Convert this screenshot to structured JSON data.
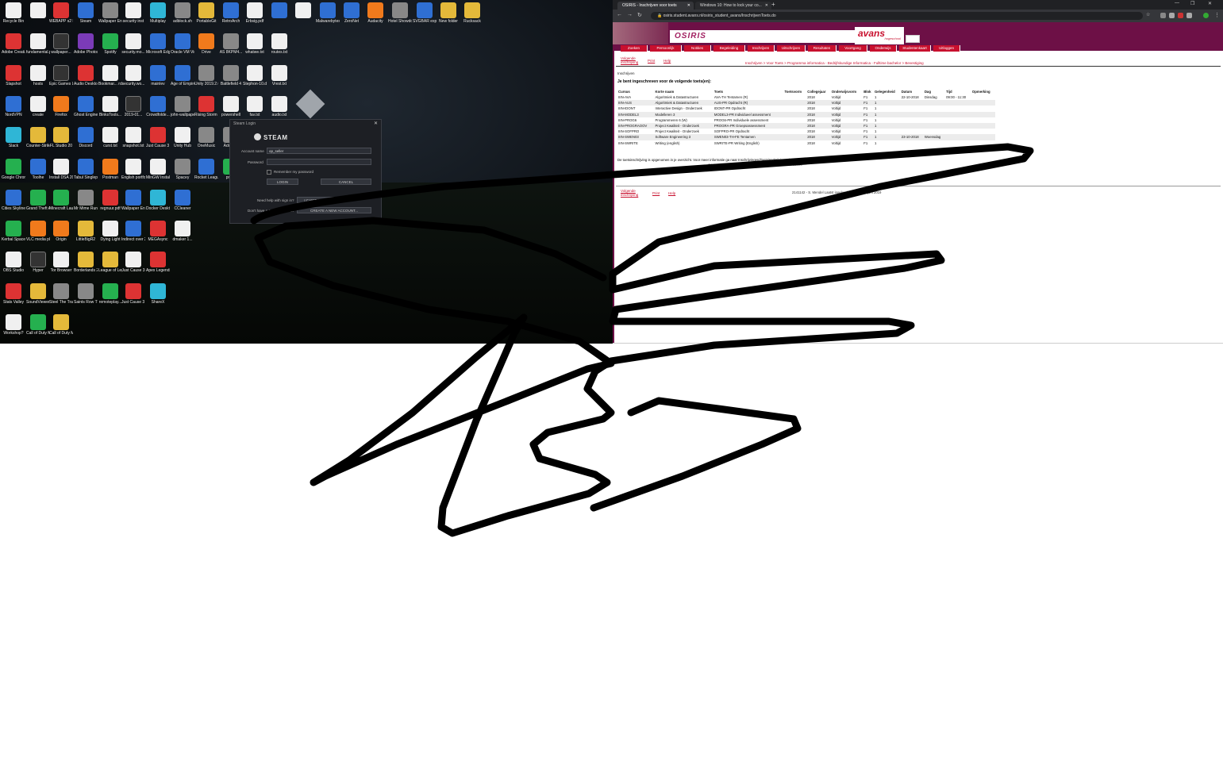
{
  "desktop": {
    "icons": [
      {
        "label": "Recycle Bin",
        "color": "g-white",
        "col": 0,
        "row": 0
      },
      {
        "label": "",
        "color": "g-white",
        "col": 1,
        "row": 0
      },
      {
        "label": "WEBAPP s2 Installation...",
        "color": "g-red",
        "col": 2,
        "row": 0
      },
      {
        "label": "Steam",
        "color": "g-blue",
        "col": 3,
        "row": 0
      },
      {
        "label": "Wallpaper Engine",
        "color": "g-gray",
        "col": 4,
        "row": 0
      },
      {
        "label": "security inst",
        "color": "g-white",
        "col": 5,
        "row": 0
      },
      {
        "label": "Multiplay",
        "color": "g-cyan",
        "col": 6,
        "row": 0
      },
      {
        "label": "adblock.sh",
        "color": "g-gray",
        "col": 7,
        "row": 0
      },
      {
        "label": "PortableGit",
        "color": "g-yellow",
        "col": 8,
        "row": 0
      },
      {
        "label": "RetroArch",
        "color": "g-blue",
        "col": 9,
        "row": 0
      },
      {
        "label": "Erbsig.pdf",
        "color": "g-white",
        "col": 10,
        "row": 0
      },
      {
        "label": "",
        "color": "g-blue",
        "col": 11,
        "row": 0
      },
      {
        "label": "",
        "color": "g-white",
        "col": 12,
        "row": 0
      },
      {
        "label": "Malwarebytes",
        "color": "g-blue",
        "col": 13,
        "row": 0
      },
      {
        "label": "ZeroNet",
        "color": "g-blue",
        "col": 14,
        "row": 0
      },
      {
        "label": "Audacity",
        "color": "g-orange",
        "col": 15,
        "row": 0
      },
      {
        "label": "Hotel Showdown",
        "color": "g-gray",
        "col": 16,
        "row": 0
      },
      {
        "label": "SVGBAR explorer",
        "color": "g-blue",
        "col": 17,
        "row": 0
      },
      {
        "label": "New folder",
        "color": "g-yellow",
        "col": 18,
        "row": 0
      },
      {
        "label": "Rucksack",
        "color": "g-yellow",
        "col": 19,
        "row": 0
      },
      {
        "label": "Adobe Creati...",
        "color": "g-red",
        "col": 0,
        "row": 1
      },
      {
        "label": "fundamental.p...",
        "color": "g-white",
        "col": 1,
        "row": 1
      },
      {
        "label": "wallpaper...",
        "color": "g-dark",
        "col": 2,
        "row": 1
      },
      {
        "label": "Adobe Photoshop",
        "color": "g-purple",
        "col": 3,
        "row": 1
      },
      {
        "label": "Spotify",
        "color": "g-green",
        "col": 4,
        "row": 1
      },
      {
        "label": "security.mo...",
        "color": "g-white",
        "col": 5,
        "row": 1
      },
      {
        "label": "Microsoft Edge",
        "color": "g-blue",
        "col": 6,
        "row": 1
      },
      {
        "label": "Oracle VM VirtualBox",
        "color": "g-blue",
        "col": 7,
        "row": 1
      },
      {
        "label": "Drive",
        "color": "g-orange",
        "col": 8,
        "row": 1
      },
      {
        "label": "AS 8KPM4...",
        "color": "g-gray",
        "col": 9,
        "row": 1
      },
      {
        "label": "whatwe.txt",
        "color": "g-white",
        "col": 10,
        "row": 1
      },
      {
        "label": "routes.txt",
        "color": "g-white",
        "col": 11,
        "row": 1
      },
      {
        "label": "Slapshot",
        "color": "g-red",
        "col": 0,
        "row": 2
      },
      {
        "label": "hosts",
        "color": "g-white",
        "col": 1,
        "row": 2
      },
      {
        "label": "Epic Games Launcher",
        "color": "g-dark",
        "col": 2,
        "row": 2
      },
      {
        "label": "Audio Desktop",
        "color": "g-red",
        "col": 3,
        "row": 2
      },
      {
        "label": "Bookmar... rdd.txt",
        "color": "g-white",
        "col": 4,
        "row": 2
      },
      {
        "label": "security.wo...",
        "color": "g-white",
        "col": 5,
        "row": 2
      },
      {
        "label": "mainlev",
        "color": "g-blue",
        "col": 6,
        "row": 2
      },
      {
        "label": "Age of Empires II",
        "color": "g-blue",
        "col": 7,
        "row": 2
      },
      {
        "label": "Unity 2019.2.0...",
        "color": "g-gray",
        "col": 8,
        "row": 2
      },
      {
        "label": "Battlefield 4",
        "color": "g-gray",
        "col": 9,
        "row": 2
      },
      {
        "label": "Stephon-10.dll",
        "color": "g-white",
        "col": 10,
        "row": 2
      },
      {
        "label": "Vrest.txt",
        "color": "g-white",
        "col": 11,
        "row": 2
      },
      {
        "label": "NordVPN",
        "color": "g-blue",
        "col": 0,
        "row": 3
      },
      {
        "label": "create",
        "color": "g-white",
        "col": 1,
        "row": 3
      },
      {
        "label": "Firefox",
        "color": "g-orange",
        "col": 2,
        "row": 3
      },
      {
        "label": "Ghost Engine",
        "color": "g-blue",
        "col": 3,
        "row": 3
      },
      {
        "label": "BinksTools...",
        "color": "g-white",
        "col": 4,
        "row": 3
      },
      {
        "label": "2019-01...",
        "color": "g-dark",
        "col": 5,
        "row": 3
      },
      {
        "label": "Crowdfolde...",
        "color": "g-blue",
        "col": 6,
        "row": 3
      },
      {
        "label": "john-wallpaper",
        "color": "g-gray",
        "col": 7,
        "row": 3
      },
      {
        "label": "Rising Storm 2 Vietnam",
        "color": "g-red",
        "col": 8,
        "row": 3
      },
      {
        "label": "powershell",
        "color": "g-white",
        "col": 9,
        "row": 3
      },
      {
        "label": "fav.txt",
        "color": "g-white",
        "col": 10,
        "row": 3
      },
      {
        "label": "audio.txt",
        "color": "g-white",
        "col": 11,
        "row": 3
      },
      {
        "label": "Slack",
        "color": "g-cyan",
        "col": 0,
        "row": 4
      },
      {
        "label": "Counter-Strike Global Off...",
        "color": "g-yellow",
        "col": 1,
        "row": 4
      },
      {
        "label": "FL Studio 20",
        "color": "g-yellow",
        "col": 2,
        "row": 4
      },
      {
        "label": "Discord",
        "color": "g-blue",
        "col": 3,
        "row": 4
      },
      {
        "label": "curst.txt",
        "color": "g-white",
        "col": 4,
        "row": 4
      },
      {
        "label": "snapshot.txt",
        "color": "g-white",
        "col": 5,
        "row": 4
      },
      {
        "label": "Just Cause 3 Multiplayer",
        "color": "g-red",
        "col": 6,
        "row": 4
      },
      {
        "label": "Unity Hub",
        "color": "g-white",
        "col": 7,
        "row": 4
      },
      {
        "label": "OneMusic",
        "color": "g-gray",
        "col": 8,
        "row": 4
      },
      {
        "label": "Adobe...",
        "color": "g-gray",
        "col": 9,
        "row": 4
      },
      {
        "label": "Google Chrome",
        "color": "g-green",
        "col": 0,
        "row": 5
      },
      {
        "label": "Toolhe",
        "color": "g-blue",
        "col": 1,
        "row": 5
      },
      {
        "label": "Install DSA 2019...",
        "color": "g-white",
        "col": 2,
        "row": 5
      },
      {
        "label": "Tabul Singleplayer",
        "color": "g-blue",
        "col": 3,
        "row": 5
      },
      {
        "label": "Postman",
        "color": "g-orange",
        "col": 4,
        "row": 5
      },
      {
        "label": "English portfolio S...",
        "color": "g-white",
        "col": 5,
        "row": 5
      },
      {
        "label": "MinGW Installer",
        "color": "g-white",
        "col": 6,
        "row": 5
      },
      {
        "label": "Spacey",
        "color": "g-gray",
        "col": 7,
        "row": 5
      },
      {
        "label": "Rocket League",
        "color": "g-blue",
        "col": 8,
        "row": 5
      },
      {
        "label": "prime",
        "color": "g-green",
        "col": 9,
        "row": 5
      },
      {
        "label": "Cities Skylines",
        "color": "g-blue",
        "col": 0,
        "row": 6
      },
      {
        "label": "Grand Theft Auto V",
        "color": "g-green",
        "col": 1,
        "row": 6
      },
      {
        "label": "Minecraft Launcher",
        "color": "g-green",
        "col": 2,
        "row": 6
      },
      {
        "label": "Mr Mime Runs in Hell",
        "color": "g-gray",
        "col": 3,
        "row": 6
      },
      {
        "label": "regnuur.pdf",
        "color": "g-red",
        "col": 4,
        "row": 6
      },
      {
        "label": "Wallpaper Engine",
        "color": "g-blue",
        "col": 5,
        "row": 6
      },
      {
        "label": "Docker Desktop",
        "color": "g-cyan",
        "col": 6,
        "row": 6
      },
      {
        "label": "CCleaner",
        "color": "g-blue",
        "col": 7,
        "row": 6
      },
      {
        "label": "Kerbal Space...",
        "color": "g-green",
        "col": 0,
        "row": 7
      },
      {
        "label": "VLC media player",
        "color": "g-orange",
        "col": 1,
        "row": 7
      },
      {
        "label": "Origin",
        "color": "g-orange",
        "col": 2,
        "row": 7
      },
      {
        "label": "LittleBigR2",
        "color": "g-yellow",
        "col": 3,
        "row": 7
      },
      {
        "label": "Dying Light",
        "color": "g-white",
        "col": 4,
        "row": 7
      },
      {
        "label": "Indirect over 2019-...",
        "color": "g-blue",
        "col": 5,
        "row": 7
      },
      {
        "label": "MEGAsync",
        "color": "g-red",
        "col": 6,
        "row": 7
      },
      {
        "label": "dmaker 1...",
        "color": "g-white",
        "col": 7,
        "row": 7
      },
      {
        "label": "OBS Studio",
        "color": "g-white",
        "col": 0,
        "row": 8
      },
      {
        "label": "Hyper",
        "color": "g-dark",
        "col": 1,
        "row": 8
      },
      {
        "label": "Tor Browser",
        "color": "g-white",
        "col": 2,
        "row": 8
      },
      {
        "label": "Borderlands 2",
        "color": "g-yellow",
        "col": 3,
        "row": 8
      },
      {
        "label": "League of Legends",
        "color": "g-yellow",
        "col": 4,
        "row": 8
      },
      {
        "label": "Just Cause 3",
        "color": "g-white",
        "col": 5,
        "row": 8
      },
      {
        "label": "Apex Legends",
        "color": "g-red",
        "col": 6,
        "row": 8
      },
      {
        "label": "Stats Valley",
        "color": "g-red",
        "col": 0,
        "row": 9
      },
      {
        "label": "SoundViewer Studio",
        "color": "g-yellow",
        "col": 1,
        "row": 9
      },
      {
        "label": "Steel The Traverse",
        "color": "g-gray",
        "col": 2,
        "row": 9
      },
      {
        "label": "Saints Row The Third",
        "color": "g-gray",
        "col": 3,
        "row": 9
      },
      {
        "label": "remoteplay...",
        "color": "g-green",
        "col": 4,
        "row": 9
      },
      {
        "label": "Just Cause 3 Multiplay...",
        "color": "g-red",
        "col": 5,
        "row": 9
      },
      {
        "label": "ShareX",
        "color": "g-cyan",
        "col": 6,
        "row": 9
      },
      {
        "label": "Workshop?",
        "color": "g-white",
        "col": 0,
        "row": 10
      },
      {
        "label": "Call of Duty Modern...",
        "color": "g-green",
        "col": 1,
        "row": 10
      },
      {
        "label": "Call of Duty Modern...",
        "color": "g-yellow",
        "col": 2,
        "row": 10
      }
    ]
  },
  "steam_dialog": {
    "window_title": "Steam Login",
    "brand": "STEAM",
    "account_label": "Account name",
    "account_value": "op_seller",
    "password_label": "Password",
    "remember_label": "Remember my password",
    "login_button": "LOGIN",
    "cancel_button": "CANCEL",
    "help_label": "Need help with sign in?",
    "help_button": "I CAN'T SIGN IN...",
    "create_label": "Don't have a Steam account?",
    "create_button": "CREATE A NEW ACCOUNT..."
  },
  "browser": {
    "tabs": [
      {
        "title": "OSIRIS - Inschrijven voor toets"
      },
      {
        "title": "Windows 10: How to lock your co..."
      }
    ],
    "url": "osiris.student.avans.nl/osiris_student_avans/InschrijvenToets.do",
    "osiris_title": "OSIRIS",
    "avans_brand": "avans",
    "avans_sub": "hogeschool",
    "menu": [
      "Zoeken",
      "Persoonlijk",
      "Notities",
      "Begeleiding",
      "Inschrijven",
      "Uitschrijven",
      "Resultaten",
      "Voortgang",
      "Onderwijs",
      "Studentenkaart",
      "Uitloggen"
    ],
    "subnav": {
      "next": "Volgende",
      "next2": "inschrijving",
      "print": "Print",
      "help": "Help"
    },
    "breadcrumb": "Inschrijven  >  Voor Toets  >  Programma informatica - Bedrijfskundige Informatica - Fulltime bachelor  >  Bevestiging",
    "page_heading": "Inschrijven",
    "intro": "Je bent ingeschreven voor de volgende toets(en):",
    "table": {
      "headers": [
        "Cursus",
        "Korte naam",
        "Toets",
        "Toetsvorm",
        "Collegejaar",
        "Onderwijsvorm",
        "Blok",
        "Gelegenheid",
        "Datum",
        "Dag",
        "Tijd",
        "Opmerking"
      ],
      "rows": [
        [
          "IIIN-AVA",
          "Algoritmiek & Datastructuren",
          "AVA-TH Tentamen (R)",
          "",
          "2018",
          "Voltijd",
          "F1",
          "1",
          "22-10-2018",
          "Dinsdag",
          "09:00 - 11:30",
          ""
        ],
        [
          "IIIN-AUS",
          "Algoritmiek & Datastructuren",
          "AUS-PR Opdracht (R)",
          "",
          "2018",
          "Voltijd",
          "F1",
          "1",
          "",
          "",
          "",
          ""
        ],
        [
          "IIIN-IDONT",
          "Interactive Design - Onderzoek",
          "IDONT-PR Opdracht",
          "",
          "2018",
          "Voltijd",
          "F1",
          "1",
          "",
          "",
          "",
          ""
        ],
        [
          "IIIN-MODEL3",
          "Modelleren 3",
          "MODEL3-PR Individueel assessment",
          "",
          "2018",
          "Voltijd",
          "F1",
          "1",
          "",
          "",
          "",
          ""
        ],
        [
          "IIIN-PROG6",
          "Programmeren 6 (W)",
          "PROG6-PR Individuele assessment",
          "",
          "2018",
          "Voltijd",
          "F1",
          "1",
          "",
          "",
          "",
          ""
        ],
        [
          "IIIN-PROGRAOOV",
          "Project Kwaliteit - Onderzoek",
          "PROGRA-PR Groepsassessment",
          "",
          "2018",
          "Voltijd",
          "F1",
          "1",
          "",
          "",
          "",
          ""
        ],
        [
          "IIIN-SOFPRO",
          "Project Kwaliteit - Onderzoek",
          "SOFPRO-PR Opdracht",
          "",
          "2018",
          "Voltijd",
          "F1",
          "1",
          "",
          "",
          "",
          ""
        ],
        [
          "IIIN-SWEN03",
          "Software Engineering 3",
          "SWEN03-TH-FE Tentamen",
          "",
          "2018",
          "Voltijd",
          "F1",
          "1",
          "23-10-2018",
          "Woensdag",
          "",
          ""
        ],
        [
          "IIIN-SWRITE",
          "Writing (english)",
          "SWRITE-PR Writing (English)",
          "",
          "2018",
          "Voltijd",
          "F1",
          "1",
          "",
          "",
          "",
          ""
        ]
      ]
    },
    "note": "De toetsinschrijving is opgenomen in je overzicht. Voor meer informatie ga naar Inschrijvingen/Toetsinschrijvingen/Voorgangsoverzicht.",
    "note2": "Ga naar studentenportaal Avans voor een actueel toetsrooster.",
    "footer_nav": {
      "next": "Volgende",
      "next2": "inschrijving",
      "print": "Print",
      "help": "Help"
    },
    "footer_info": "2141142 - S. Mendel   Laatst ingelogd zaterdag 22 juni 2019"
  },
  "colors": {
    "osiris_maroon": "#6d1046",
    "avans_red": "#c8102e"
  }
}
